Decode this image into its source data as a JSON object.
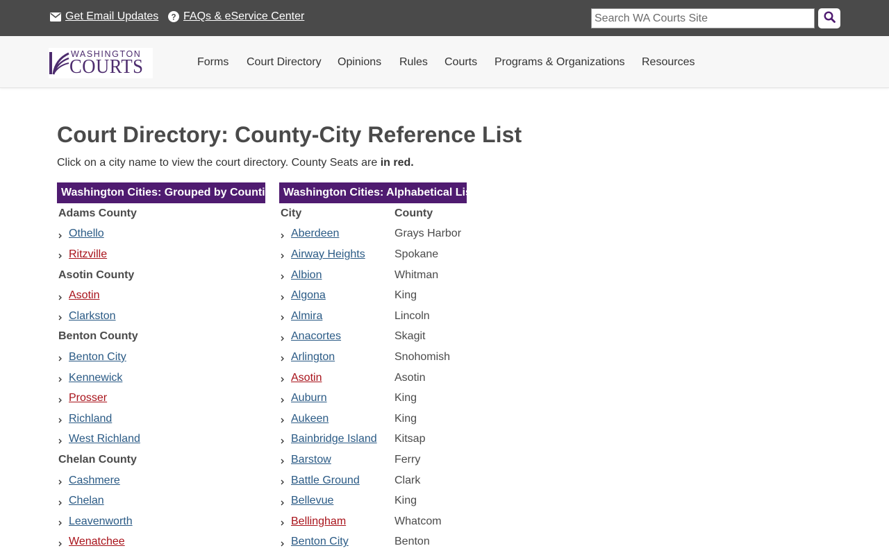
{
  "utility": {
    "email_label": "Get Email Updates",
    "faq_label": "FAQs & eService Center",
    "search_placeholder": "Search WA Courts Site"
  },
  "logo": {
    "top": "WASHINGTON",
    "bottom": "COURTS"
  },
  "nav": {
    "items": [
      "Forms",
      "Court Directory",
      "Opinions",
      "Rules",
      "Courts",
      "Programs & Organizations",
      "Resources"
    ]
  },
  "page": {
    "title": "Court Directory: County-City Reference List",
    "intro": "Click on a city name to view the court directory. County Seats are ",
    "intro_bold": "in red."
  },
  "grouped": {
    "header": "Washington Cities: Grouped by Counties",
    "counties": [
      {
        "name": "Adams County",
        "cities": [
          {
            "name": "Othello",
            "seat": false
          },
          {
            "name": "Ritzville",
            "seat": true
          }
        ]
      },
      {
        "name": "Asotin County",
        "cities": [
          {
            "name": "Asotin",
            "seat": true
          },
          {
            "name": "Clarkston",
            "seat": false
          }
        ]
      },
      {
        "name": "Benton County",
        "cities": [
          {
            "name": "Benton City",
            "seat": false
          },
          {
            "name": "Kennewick",
            "seat": false
          },
          {
            "name": "Prosser",
            "seat": true
          },
          {
            "name": "Richland",
            "seat": false
          },
          {
            "name": "West Richland",
            "seat": false
          }
        ]
      },
      {
        "name": "Chelan County",
        "cities": [
          {
            "name": "Cashmere",
            "seat": false
          },
          {
            "name": "Chelan",
            "seat": false
          },
          {
            "name": "Leavenworth",
            "seat": false
          },
          {
            "name": "Wenatchee",
            "seat": true
          }
        ]
      }
    ]
  },
  "alphabetical": {
    "header": "Washington Cities: Alphabetical List",
    "col_city": "City",
    "col_county": "County",
    "rows": [
      {
        "city": "Aberdeen",
        "county": "Grays Harbor",
        "seat": false
      },
      {
        "city": "Airway Heights",
        "county": "Spokane",
        "seat": false
      },
      {
        "city": "Albion",
        "county": "Whitman",
        "seat": false
      },
      {
        "city": "Algona",
        "county": "King",
        "seat": false
      },
      {
        "city": "Almira",
        "county": "Lincoln",
        "seat": false
      },
      {
        "city": "Anacortes",
        "county": "Skagit",
        "seat": false
      },
      {
        "city": "Arlington",
        "county": "Snohomish",
        "seat": false
      },
      {
        "city": "Asotin",
        "county": "Asotin",
        "seat": true
      },
      {
        "city": "Auburn",
        "county": "King",
        "seat": false
      },
      {
        "city": "Aukeen",
        "county": "King",
        "seat": false
      },
      {
        "city": "Bainbridge Island",
        "county": "Kitsap",
        "seat": false
      },
      {
        "city": "Barstow",
        "county": "Ferry",
        "seat": false
      },
      {
        "city": "Battle Ground",
        "county": "Clark",
        "seat": false
      },
      {
        "city": "Bellevue",
        "county": "King",
        "seat": false
      },
      {
        "city": "Bellingham",
        "county": "Whatcom",
        "seat": true
      },
      {
        "city": "Benton City",
        "county": "Benton",
        "seat": false
      }
    ]
  },
  "colors": {
    "utility_bg": "#4a4a4a",
    "brand_purple": "#4f1b70",
    "link": "#2a5a85",
    "county_seat": "#a8121a"
  },
  "icons": {
    "email": "envelope-icon",
    "faq": "question-circle-icon",
    "search": "magnifier-icon",
    "list_bullet": "chevron-right-icon"
  }
}
